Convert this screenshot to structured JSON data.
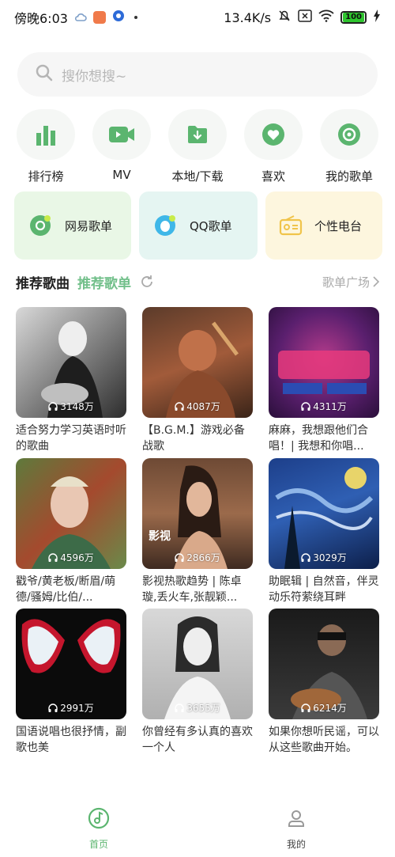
{
  "status_bar": {
    "time": "傍晚6:03",
    "speed": "13.4K/s",
    "battery": "100"
  },
  "search": {
    "placeholder": "搜你想搜~"
  },
  "quick_actions": [
    {
      "label": "排行榜",
      "icon": "bar-chart-icon"
    },
    {
      "label": "MV",
      "icon": "video-icon"
    },
    {
      "label": "本地/下载",
      "icon": "download-folder-icon"
    },
    {
      "label": "喜欢",
      "icon": "heart-icon"
    },
    {
      "label": "我的歌单",
      "icon": "disc-icon"
    }
  ],
  "sources": [
    {
      "label": "网易歌单",
      "icon": "netease-icon",
      "bg": "#e9f7e6"
    },
    {
      "label": "QQ歌单",
      "icon": "qq-icon",
      "bg": "#e5f5f2"
    },
    {
      "label": "个性电台",
      "icon": "radio-icon",
      "bg": "#fdf6de"
    }
  ],
  "section": {
    "title": "推荐歌曲",
    "subtitle": "推荐歌单",
    "more": "歌单广场"
  },
  "playlists": [
    {
      "plays": "3148万",
      "title": "适合努力学习英语时听的歌曲",
      "caption": ""
    },
    {
      "plays": "4087万",
      "title": "【B.G.M.】游戏必备战歌",
      "caption": ""
    },
    {
      "plays": "4311万",
      "title": "麻麻，我想跟他们合唱！| 我想和你唱...",
      "caption": ""
    },
    {
      "plays": "4596万",
      "title": "戳爷/黄老板/断眉/萌德/骚姆/比伯/...",
      "caption": ""
    },
    {
      "plays": "2866万",
      "title": "影视热歌趋势 | 陈卓璇,丢火车,张靓颖...",
      "caption": "影视"
    },
    {
      "plays": "3029万",
      "title": "助眠辑 | 自然音，伴灵动乐符萦绕耳畔",
      "caption": ""
    },
    {
      "plays": "2991万",
      "title": "国语说唱也很抒情，副歌也美",
      "caption": ""
    },
    {
      "plays": "3655万",
      "title": "你曾经有多认真的喜欢一个人",
      "caption": ""
    },
    {
      "plays": "6214万",
      "title": "如果你想听民谣，可以从这些歌曲开始。",
      "caption": ""
    }
  ],
  "bottom_nav": [
    {
      "label": "首页",
      "active": true
    },
    {
      "label": "我的",
      "active": false
    }
  ],
  "colors": {
    "accent": "#5bb56f"
  }
}
